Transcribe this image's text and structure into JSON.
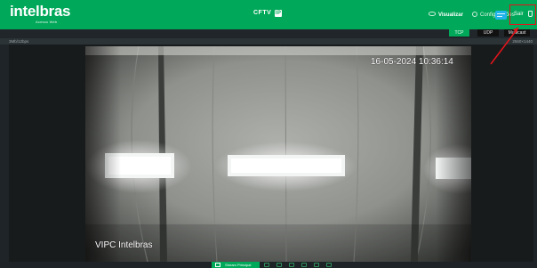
{
  "header": {
    "logo": "intelbras",
    "logo_subtitle": "Acesso Web",
    "brand": "CFTV",
    "brand_badge": "IP",
    "nav": {
      "visualizar_label": "Visualizar",
      "configuracoes_label": "Configurações",
      "sair_label": "Sair"
    }
  },
  "protocols": {
    "tcp": "TCP",
    "udp": "UDP",
    "multicast": "Multicast",
    "selected": "TCP"
  },
  "stream_info": {
    "left": "3Mb/12bps",
    "right": "2560×1440"
  },
  "video": {
    "timestamp": "16-05-2024 10:36:14",
    "camera_name": "VIPC Intelbras"
  },
  "toolbar": {
    "main_stream_label": "Stream Principal"
  },
  "colors": {
    "brand_green": "#00a859",
    "highlight_red": "#e3141b",
    "tile_blue": "#1fb3ea"
  },
  "icons": [
    "eye-icon",
    "gear-icon",
    "app-tile-icon",
    "exit-icon",
    "record-icon",
    "snapshot-icon",
    "zoom-icon",
    "audio-icon",
    "fullscreen-icon"
  ]
}
